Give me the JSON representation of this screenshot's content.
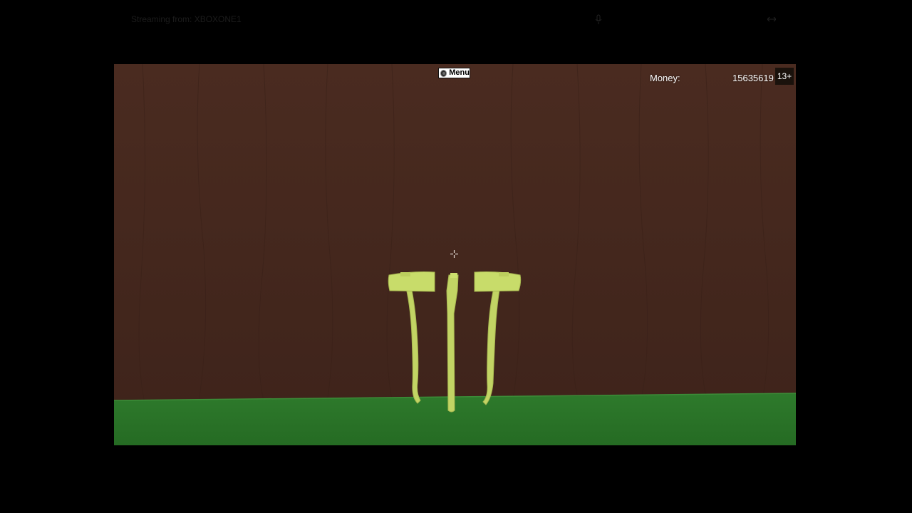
{
  "stream": {
    "label": "Streaming from: XBOXONE1",
    "mic_icon": "microphone-icon",
    "expand_icon": "expand-icon"
  },
  "hud": {
    "menu_label": "Menu",
    "menu_icon": "xbox-button-icon",
    "money_label": "Money:",
    "money_value": "15635619",
    "age_rating": "13+",
    "crosshair_icon": "crosshair-icon"
  },
  "scene": {
    "wall_color": "#4a2b20",
    "floor_color": "#2e7a2c",
    "axe_color": "#c8dc6a",
    "objects": [
      "axe-left",
      "axe-handle-center",
      "axe-right"
    ]
  }
}
